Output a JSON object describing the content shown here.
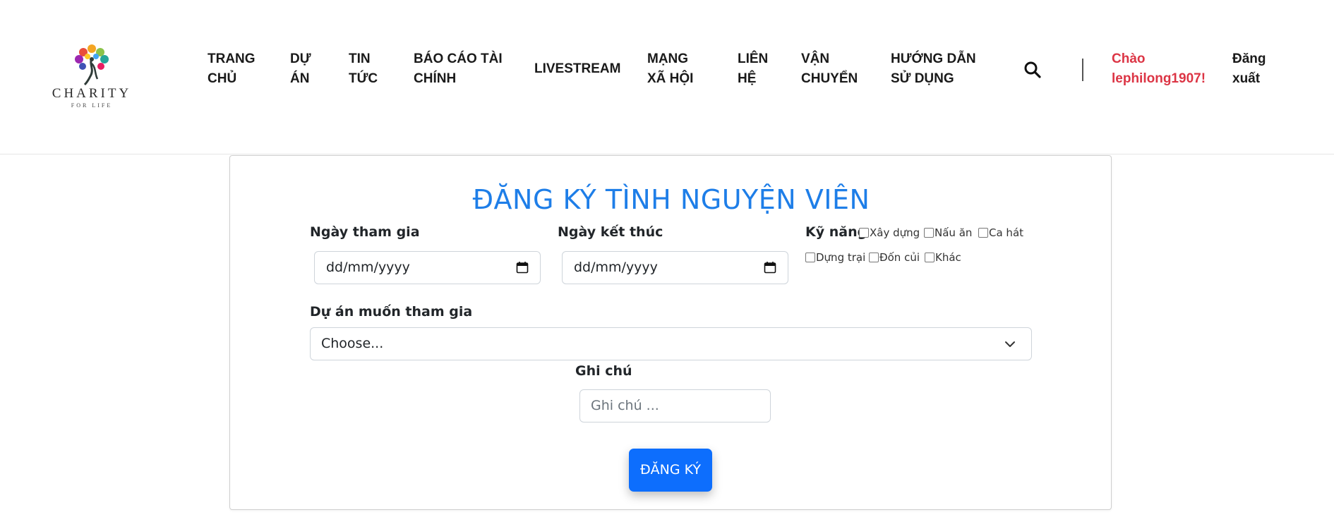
{
  "brand": {
    "logo_name": "CHARITY",
    "logo_tagline": "FOR LIFE"
  },
  "nav": {
    "items": [
      {
        "line1": "TRANG",
        "line2": "CHỦ"
      },
      {
        "line1": "DỰ",
        "line2": "ÁN"
      },
      {
        "line1": "TIN",
        "line2": "TỨC"
      },
      {
        "line1": "BÁO CÁO TÀI",
        "line2": "CHÍNH"
      },
      {
        "line1": "LIVESTREAM",
        "line2": ""
      },
      {
        "line1": "MẠNG",
        "line2": "XÃ HỘI"
      },
      {
        "line1": "LIÊN",
        "line2": "HỆ"
      },
      {
        "line1": "VẬN",
        "line2": "CHUYỂN"
      },
      {
        "line1": "HƯỚNG DẪN",
        "line2": "SỬ DỤNG"
      }
    ],
    "greeting_line1": "Chào",
    "greeting_line2": "lephilong1907!",
    "logout_line1": "Đăng",
    "logout_line2": "xuất"
  },
  "form": {
    "title": "ĐĂNG KÝ TÌNH NGUYỆN VIÊN",
    "start_date_label": "Ngày tham gia",
    "start_date_value": "dd/mm/yyyy",
    "end_date_label": "Ngày kết thúc",
    "end_date_value": "dd/mm/yyyy",
    "skills_label": "Kỹ năng",
    "skills": [
      "Xây dựng",
      "Nấu ăn",
      "Ca hát",
      "Dựng trại",
      "Đốn củi",
      "Khác"
    ],
    "project_label": "Dự án muốn tham gia",
    "project_value": "Choose...",
    "note_label": "Ghi chú",
    "note_placeholder": "Ghi chú ...",
    "submit_label": "ĐĂNG KÝ"
  },
  "colors": {
    "title_blue": "#1e7ee8",
    "button_blue": "#0d6efd",
    "greeting_red": "#dc3545"
  }
}
